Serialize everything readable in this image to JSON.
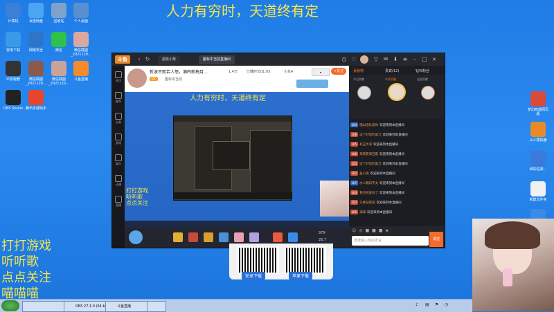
{
  "banner": "人力有穷时，天道终有定",
  "overlay_lines": [
    "打打游戏",
    "听听歌",
    "点点关注",
    "喵喵喵"
  ],
  "desktop_icons_left": [
    {
      "label": "计算机",
      "color": "#3b7fd8"
    },
    {
      "label": "百度网盘",
      "color": "#4aa6f5"
    },
    {
      "label": "回收站",
      "color": "#7fa3c8"
    },
    {
      "label": "个人桌面",
      "color": "#5a8fcf"
    },
    {
      "label": "雷电下载",
      "color": "#3a9ae8"
    },
    {
      "label": "网络安全",
      "color": "#2e75c9"
    },
    {
      "label": "微信",
      "color": "#2ec24a"
    },
    {
      "label": "微信截图_2021120...",
      "color": "#d9a9a0"
    },
    {
      "label": "IP加速器",
      "color": "#333"
    },
    {
      "label": "微信截图_2021120...",
      "color": "#8b5a4a"
    },
    {
      "label": "微信截图_2021120...",
      "color": "#c9a39a"
    },
    {
      "label": "斗鱼直播",
      "color": "#f58a2a"
    },
    {
      "label": "OBS Studio",
      "color": "#222"
    },
    {
      "label": "腾讯手游助手",
      "color": "#e8452e"
    }
  ],
  "desktop_icons_right": [
    {
      "label": "梦幻西游网页版",
      "color": "#d94a3a"
    },
    {
      "label": "山人模拟器",
      "color": "#e88a2a"
    },
    {
      "label": "谁的狂歌...",
      "color": "#3a7ad8"
    },
    {
      "label": "新建文件夹",
      "color": "#f1f1f1"
    },
    {
      "label": "文件",
      "color": "#3a8ae8"
    }
  ],
  "window": {
    "logo": "斗鱼",
    "tabs": [
      "超级小桀",
      "图标中当前直播间"
    ],
    "sidenav": [
      "关注",
      "推荐",
      "分类",
      "游戏",
      "娱乐",
      "动漫",
      "直播"
    ],
    "streamer_name": "新波不熙若人怒，满鸣新梅月...",
    "streamer_sub": "图标中当前",
    "stats": [
      "1.4万",
      "已播时长01:05",
      "小车4"
    ],
    "follow_button": "+关注",
    "right_tabs": [
      "贡献榜",
      "贵宾(12)",
      "钻石粉丝"
    ],
    "rank_labels": [
      "今日贡献",
      "本周贡献",
      "全部贡献"
    ],
    "chat_input_placeholder": "发送输入你的发言",
    "send_button": "发送",
    "chat": [
      {
        "badge": "LV4",
        "badge_color": "#3a6fc8",
        "user": "喵似团队爱你",
        "text": "欢迎来到本直播间"
      },
      {
        "badge": "LV8",
        "badge_color": "#c8503a",
        "user": "这个好玩的美刀",
        "text": "欢迎来到本直播间"
      },
      {
        "badge": "LV5",
        "badge_color": "#c8503a",
        "user": "有丑大哥",
        "text": "欢迎来到本直播间"
      },
      {
        "badge": "LV6",
        "badge_color": "#c8503a",
        "user": "来宾客来回家",
        "text": "欢迎来到本直播间"
      },
      {
        "badge": "LV3",
        "badge_color": "#c8503a",
        "user": "这个好玩的美刀",
        "text": "欢迎来到本直播间"
      },
      {
        "badge": "LV2",
        "badge_color": "#c8503a",
        "user": "鱼小森",
        "text": "欢迎来到本直播间"
      },
      {
        "badge": "LV7",
        "badge_color": "#3a6fc8",
        "user": "水人魏白不太",
        "text": "欢迎来到本直播间"
      },
      {
        "badge": "LV4",
        "badge_color": "#c8503a",
        "user": "我已经爱你了",
        "text": "欢迎来到本直播间"
      },
      {
        "badge": "LV3",
        "badge_color": "#c8503a",
        "user": "只要记得说",
        "text": "欢迎来到本直播间"
      },
      {
        "badge": "LV5",
        "badge_color": "#c8503a",
        "user": "满满",
        "text": "欢迎来到本直播间"
      }
    ],
    "giftbar_counts": [
      "979",
      "26.7"
    ]
  },
  "qr": {
    "android_label": "安卓下载",
    "apple_label": "苹果下载"
  },
  "taskbar": {
    "tasks": [
      "",
      "OBS 27.1.0 (64-bit...",
      "斗鱼直播",
      "20211201..."
    ],
    "time": "",
    "tray_icons": [
      "volume-icon",
      "network-icon"
    ]
  }
}
